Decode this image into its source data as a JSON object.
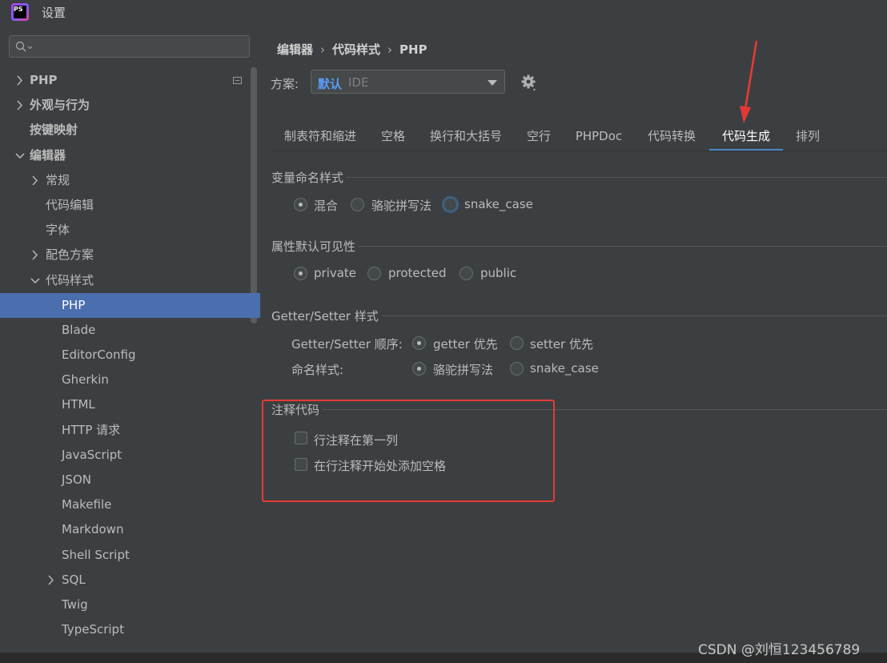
{
  "window": {
    "title": "设置",
    "logo_text": "PS"
  },
  "search": {
    "placeholder": ""
  },
  "sidebar": {
    "items": [
      {
        "label": "PHP"
      },
      {
        "label": "外观与行为"
      },
      {
        "label": "按键映射"
      },
      {
        "label": "编辑器"
      },
      {
        "label": "常规"
      },
      {
        "label": "代码编辑"
      },
      {
        "label": "字体"
      },
      {
        "label": "配色方案"
      },
      {
        "label": "代码样式"
      },
      {
        "label": "PHP"
      },
      {
        "label": "Blade"
      },
      {
        "label": "EditorConfig"
      },
      {
        "label": "Gherkin"
      },
      {
        "label": "HTML"
      },
      {
        "label": "HTTP 请求"
      },
      {
        "label": "JavaScript"
      },
      {
        "label": "JSON"
      },
      {
        "label": "Makefile"
      },
      {
        "label": "Markdown"
      },
      {
        "label": "Shell Script"
      },
      {
        "label": "SQL"
      },
      {
        "label": "Twig"
      },
      {
        "label": "TypeScript"
      }
    ]
  },
  "breadcrumb": {
    "items": [
      "编辑器",
      "代码样式",
      "PHP"
    ],
    "separator": "›"
  },
  "scheme": {
    "label": "方案:",
    "value": "默认",
    "type": "IDE"
  },
  "tabs": [
    {
      "label": "制表符和缩进"
    },
    {
      "label": "空格"
    },
    {
      "label": "换行和大括号"
    },
    {
      "label": "空行"
    },
    {
      "label": "PHPDoc"
    },
    {
      "label": "代码转换"
    },
    {
      "label": "代码生成",
      "active": true
    },
    {
      "label": "排列"
    }
  ],
  "groups": {
    "variable_naming": {
      "title": "变量命名样式",
      "options": [
        {
          "label": "混合",
          "checked": true
        },
        {
          "label": "骆驼拼写法",
          "checked": false
        },
        {
          "label": "snake_case",
          "checked": false,
          "focused": true
        }
      ]
    },
    "property_visibility": {
      "title": "属性默认可见性",
      "options": [
        {
          "label": "private",
          "checked": true
        },
        {
          "label": "protected",
          "checked": false
        },
        {
          "label": "public",
          "checked": false
        }
      ]
    },
    "getter_setter": {
      "title": "Getter/Setter 样式",
      "order_label": "Getter/Setter 顺序:",
      "order_options": [
        {
          "label": "getter 优先",
          "checked": true
        },
        {
          "label": "setter 优先",
          "checked": false
        }
      ],
      "naming_label": "命名样式:",
      "naming_options": [
        {
          "label": "骆驼拼写法",
          "checked": true
        },
        {
          "label": "snake_case",
          "checked": false
        }
      ]
    },
    "comment_code": {
      "title": "注释代码",
      "options": [
        {
          "label": "行注释在第一列",
          "checked": false
        },
        {
          "label": "在行注释开始处添加空格",
          "checked": false
        }
      ]
    }
  },
  "annotation": {
    "highlight_color": "#e53935"
  },
  "watermark": "CSDN @刘恒123456789",
  "colors": {
    "accent": "#4b6eaf",
    "tab_underline": "#4a88c7",
    "scheme_value": "#589df6"
  }
}
